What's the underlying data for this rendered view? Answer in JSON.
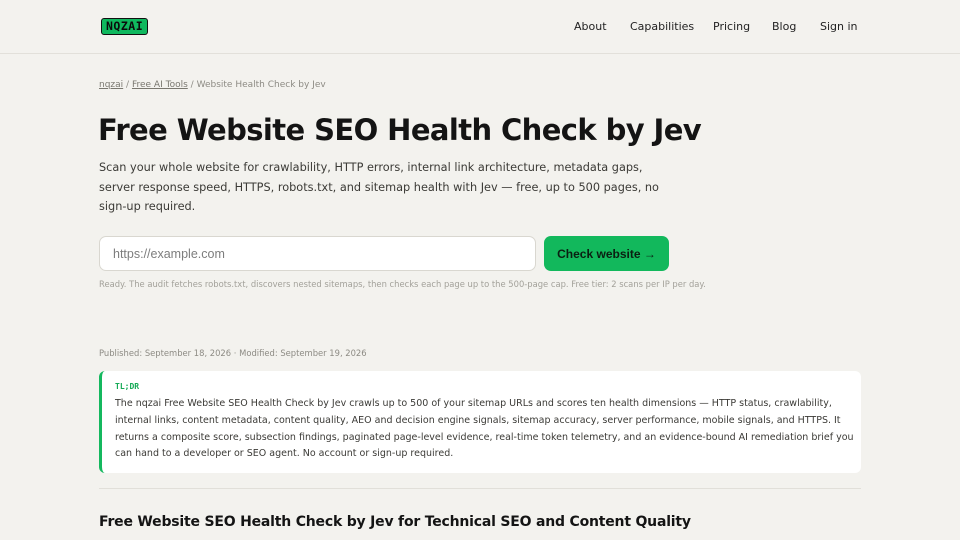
{
  "header": {
    "logo_text": "NQZAI",
    "nav": [
      "About",
      "Capabilities",
      "Pricing",
      "Blog",
      "Sign in"
    ]
  },
  "breadcrumb": {
    "items": [
      "nqzai",
      "Free AI Tools"
    ],
    "separator": "/",
    "current": "Website Health Check by Jev"
  },
  "hero": {
    "title": "Free Website SEO Health Check by Jev",
    "lede": "Scan your whole website for crawlability, HTTP errors, internal link architecture, metadata gaps, server response speed, HTTPS, robots.txt, and sitemap health with Jev — free, up to 500 pages, no sign-up required."
  },
  "scan_form": {
    "input_value": "",
    "input_placeholder": "https://example.com",
    "button_label": "Check website →",
    "status_text": "Ready. The audit fetches robots.txt, discovers nested sitemaps, then checks each page up to the 500-page cap. Free tier: 2 scans per IP per day."
  },
  "meta": {
    "published_label": "Published:",
    "published_date": "September 18, 2026",
    "separator": "·",
    "modified_label": "Modified:",
    "modified_date": "September 19, 2026"
  },
  "tldr": {
    "label": "TL;DR",
    "body": "The nqzai Free Website SEO Health Check by Jev crawls up to 500 of your sitemap URLs and scores ten health dimensions — HTTP status, crawlability, internal links, content metadata, content quality, AEO and decision engine signals, sitemap accuracy, server performance, mobile signals, and HTTPS. It returns a composite score, subsection findings, paginated page-level evidence, real-time token telemetry, and an evidence-bound AI remediation brief you can hand to a developer or SEO agent. No account or sign-up required."
  },
  "section": {
    "heading": "Free Website SEO Health Check by Jev for Technical SEO and Content Quality"
  },
  "colors": {
    "background": "#f3f2ee",
    "accent": "#12b85c",
    "text": "#141414",
    "muted": "#8d8b84"
  }
}
